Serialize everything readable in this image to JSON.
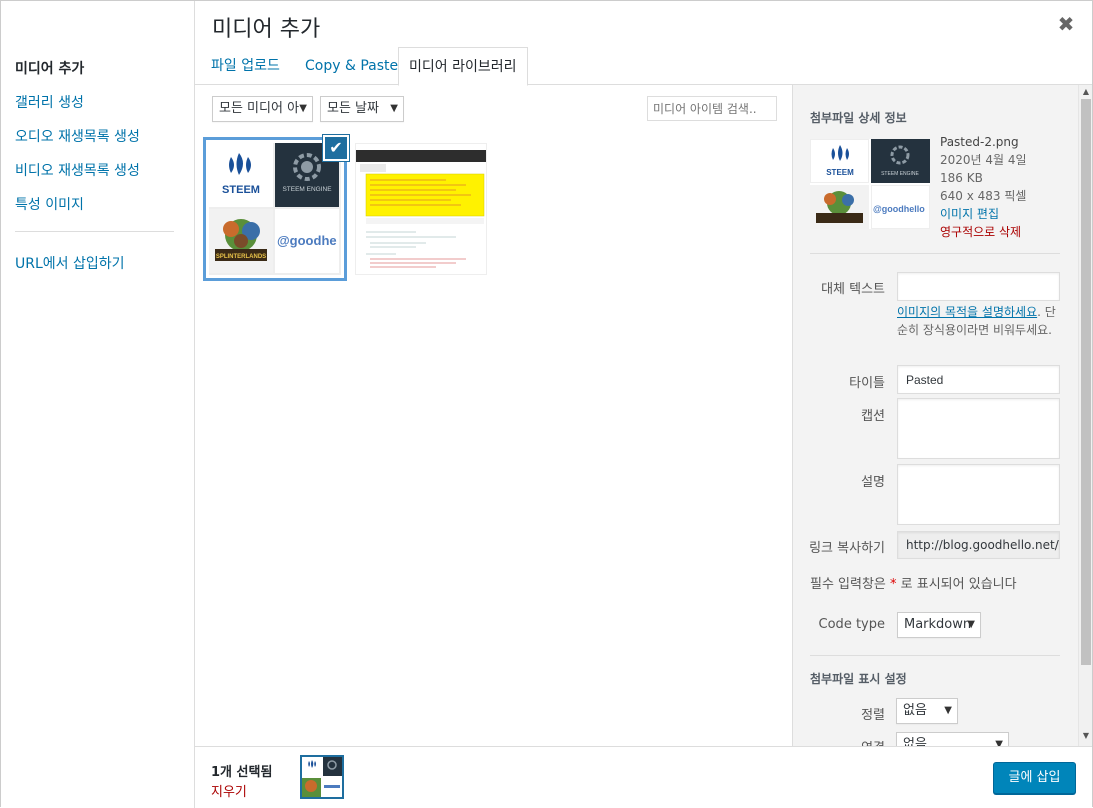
{
  "menu": {
    "items": [
      {
        "label": "미디어 추가",
        "active": true
      },
      {
        "label": "갤러리 생성"
      },
      {
        "label": "오디오 재생목록 생성"
      },
      {
        "label": "비디오 재생목록 생성"
      },
      {
        "label": "특성 이미지"
      }
    ],
    "url_insert": "URL에서 삽입하기"
  },
  "header": {
    "title": "미디어 추가",
    "close_symbol": "✖"
  },
  "tabs": [
    {
      "label": "파일 업로드"
    },
    {
      "label": "Copy & Paste"
    },
    {
      "label": "미디어 라이브러리",
      "active": true
    }
  ],
  "toolbar": {
    "media_filter": "모든 미디어 아",
    "date_filter": "모든 날짜",
    "search_placeholder": "미디어 아이템 검색.."
  },
  "thumbnail": {
    "steem_text": "STEEM",
    "engine_text": "STEEM ENGINE",
    "goodhello_text": "@goodhe",
    "goodhello_full": "@goodhello",
    "splinter_text": "SPLINTERLANDS"
  },
  "details": {
    "heading": "첨부파일 상세 정보",
    "filename": "Pasted-2.png",
    "date": "2020년 4월 4일",
    "size": "186 KB",
    "dimensions": "640 x 483 픽셀",
    "edit_link": "이미지 편집",
    "delete_link": "영구적으로 삭제",
    "alt_label": "대체 텍스트",
    "alt_value": "",
    "alt_help_link": "이미지의 목적을 설명하세요",
    "alt_help_rest": ". 단순히 장식용이라면 비워두세요.",
    "title_label": "타이틀",
    "title_value": "Pasted",
    "caption_label": "캡션",
    "caption_value": "",
    "description_label": "설명",
    "description_value": "",
    "link_label": "링크 복사하기",
    "link_value": "http://blog.goodhello.net/wp-",
    "required_note_pre": "필수 입력창은 ",
    "required_star": "*",
    "required_note_post": " 로 표시되어 있습니다",
    "code_type_label": "Code type",
    "code_type_value": "Markdown",
    "display_heading": "첨부파일 표시 설정",
    "align_label": "정렬",
    "align_value": "없음",
    "link_to_label": "연결",
    "link_to_value": "없음"
  },
  "footer": {
    "selected_count": "1개 선택됨",
    "clear_label": "지우기",
    "insert_button": "글에 삽입"
  },
  "colors": {
    "accent": "#0073aa",
    "button": "#0085ba",
    "danger": "#a00",
    "selection": "#1e6e9f"
  }
}
